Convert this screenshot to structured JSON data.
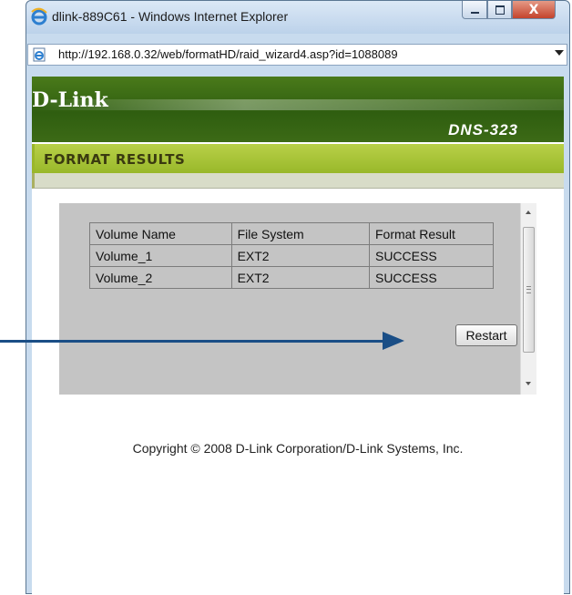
{
  "window": {
    "title": "dlink-889C61 - Windows Internet Explorer",
    "url": "http://192.168.0.32/web/formatHD/raid_wizard4.asp?id=1088089",
    "buttons": {
      "minimize": "minimize",
      "maximize": "maximize",
      "close": "X"
    }
  },
  "header": {
    "brand": "D-Link",
    "model": "DNS-323"
  },
  "section": {
    "title": "FORMAT RESULTS"
  },
  "table": {
    "columns": [
      "Volume Name",
      "File System",
      "Format Result"
    ],
    "rows": [
      [
        "Volume_1",
        "EXT2",
        "SUCCESS"
      ],
      [
        "Volume_2",
        "EXT2",
        "SUCCESS"
      ]
    ]
  },
  "actions": {
    "restart_label": "Restart"
  },
  "footer": {
    "copyright": "Copyright © 2008 D-Link Corporation/D-Link Systems, Inc."
  },
  "colors": {
    "header_green": "#2f5e10",
    "section_green": "#a4c036",
    "panel_gray": "#c4c4c4",
    "callout_blue": "#1a4e86"
  },
  "icons": [
    "ie-logo-icon",
    "page-icon",
    "dropdown-arrow-icon",
    "scroll-up-icon",
    "scroll-down-icon",
    "callout-arrow-icon"
  ]
}
